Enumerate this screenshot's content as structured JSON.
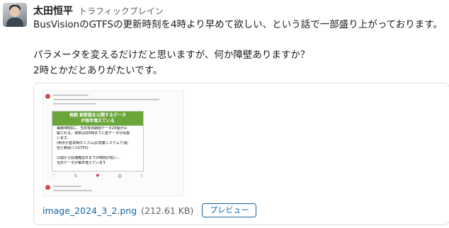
{
  "message": {
    "author": "太田恒平",
    "organization": "トラフィックブレイン",
    "lines": [
      "BusVisionのGTFSの更新時刻を4時より早めて欲しい、という話で一部盛り上がっております。",
      "パラメータを変えるだけだと思いますが、何か障壁ありますか？",
      "2時とかだとありがたいです。"
    ]
  },
  "attachment": {
    "file_name": "image_2024_3_2.png",
    "file_size": "(212.61 KB)",
    "preview_label": "プレビュー",
    "thumbnail": {
      "slide_title_1": "毎朝 更新版を公開するデータ",
      "slide_title_2": "が毎年増えている",
      "slide_lines": [
        "毎朝4時前に、当日有効期限データ20個が公",
        "開される。通常は前5時までに各データが出揃",
        "います。",
        "(明示が基本時のリズムは(商業システムで)配",
        "信と郵便バスGTFS)",
        "",
        "公開から段階確認日までの時間が短い…",
        "当日データが毎年増えています"
      ],
      "actions": [
        "♡",
        "⇅",
        "♥",
        "▥",
        "⇪"
      ]
    }
  }
}
